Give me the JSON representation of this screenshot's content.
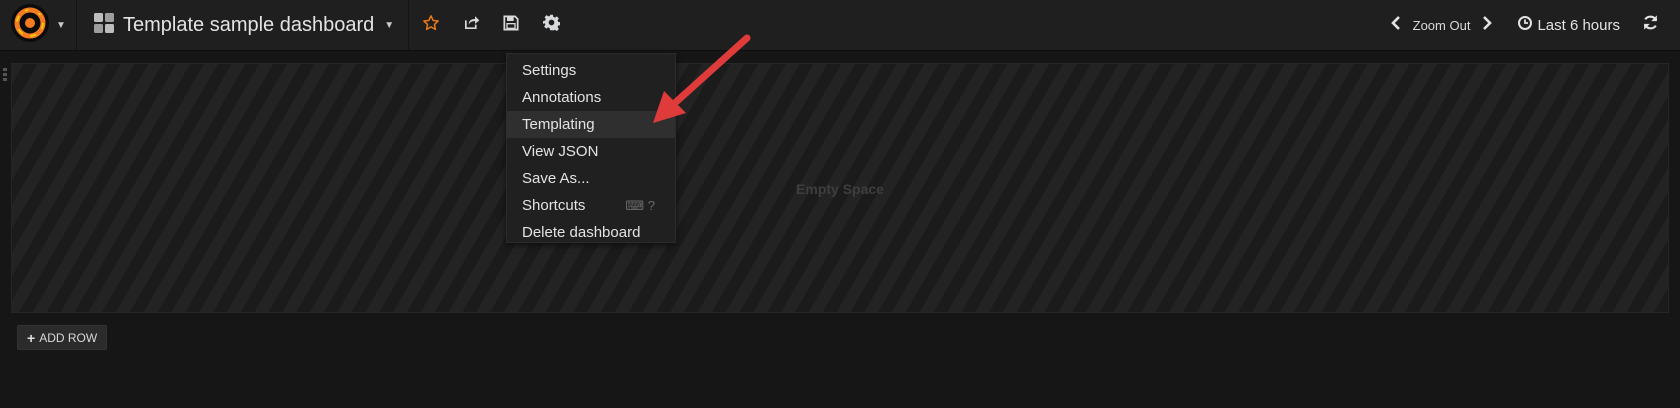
{
  "navbar": {
    "dashboard_title": "Template sample dashboard",
    "zoom_out_label": "Zoom Out",
    "time_range_label": "Last 6 hours"
  },
  "dropdown": {
    "items": [
      {
        "label": "Settings"
      },
      {
        "label": "Annotations"
      },
      {
        "label": "Templating"
      },
      {
        "label": "View JSON"
      },
      {
        "label": "Save As..."
      },
      {
        "label": "Shortcuts",
        "hint": "⌨ ?"
      },
      {
        "label": "Delete dashboard"
      }
    ],
    "active_item": "Templating"
  },
  "panel": {
    "empty_text": "Empty Space"
  },
  "add_row_label": "ADD ROW",
  "colors": {
    "logo_orange": "#f47b20",
    "star_orange": "#eb7b18",
    "arrow_red": "#e03b3b",
    "background": "#161616",
    "navbar_bg": "#1f1f20"
  },
  "icons": {
    "logo": "grafana-logo-icon",
    "dashboard": "dashboard-grid-icon",
    "star": "star-icon",
    "share": "share-icon",
    "save": "save-icon",
    "settings": "gear-icon",
    "zoom_prev": "chevron-left-icon",
    "zoom_next": "chevron-right-icon",
    "clock": "clock-icon",
    "refresh": "refresh-icon"
  }
}
